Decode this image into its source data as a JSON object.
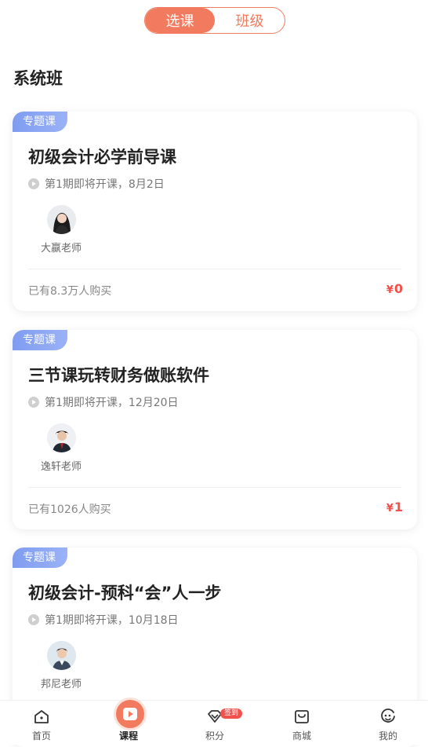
{
  "tabs": {
    "active": "选课",
    "inactive": "班级"
  },
  "section_title": "系统班",
  "courses": [
    {
      "tag": "专题课",
      "title": "初级会计必学前导课",
      "session": "第1期即将开课，8月2日",
      "teacher": "大嬴老师",
      "buyers": "已有8.3万人购买",
      "price_symbol": "¥",
      "price": "0"
    },
    {
      "tag": "专题课",
      "title": "三节课玩转财务做账软件",
      "session": "第1期即将开课，12月20日",
      "teacher": "逸轩老师",
      "buyers": "已有1026人购买",
      "price_symbol": "¥",
      "price": "1"
    },
    {
      "tag": "专题课",
      "title": "初级会计-预科“会”人一步",
      "session": "第1期即将开课，10月18日",
      "teacher": "邦尼老师",
      "buyers": "",
      "price_symbol": "",
      "price": ""
    }
  ],
  "nav": {
    "home": "首页",
    "courses": "课程",
    "points": "积分",
    "points_badge": "签到",
    "mall": "商城",
    "mine": "我的"
  },
  "colors": {
    "accent": "#f27b5f",
    "price": "#f1504b",
    "tag": "#8aa6f3"
  }
}
